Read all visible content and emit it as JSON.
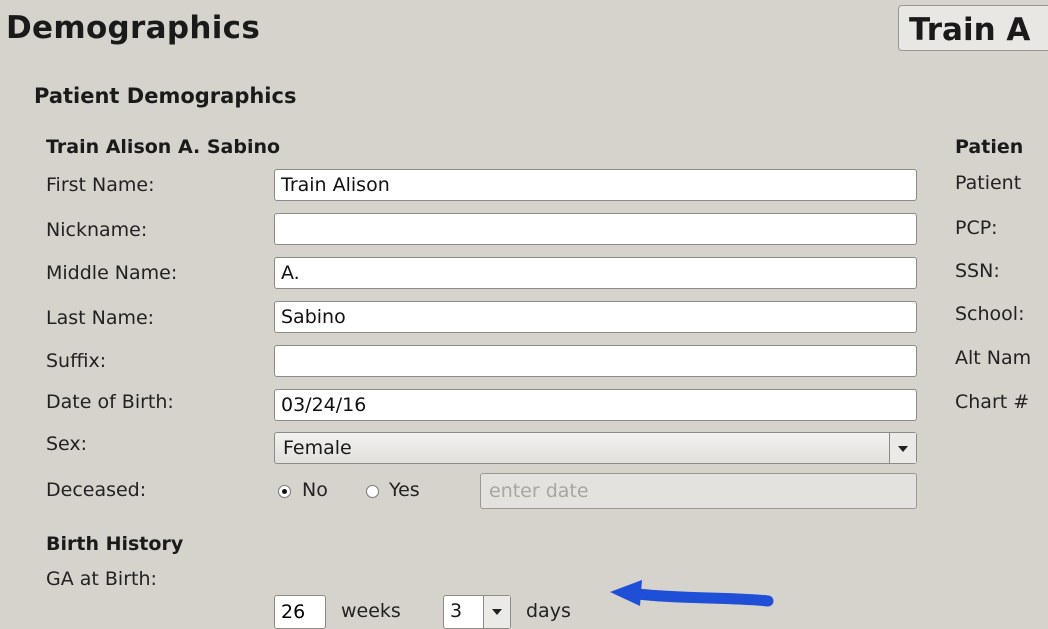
{
  "header": {
    "title": "Demographics",
    "patient_button": "Train A"
  },
  "section": {
    "title": "Patient Demographics",
    "patient_full_name": "Train Alison A. Sabino"
  },
  "form": {
    "first_name": {
      "label": "First Name:",
      "value": "Train Alison"
    },
    "nickname": {
      "label": "Nickname:",
      "value": ""
    },
    "middle_name": {
      "label": "Middle Name:",
      "value": "A."
    },
    "last_name": {
      "label": "Last Name:",
      "value": "Sabino"
    },
    "suffix": {
      "label": "Suffix:",
      "value": ""
    },
    "dob": {
      "label": "Date of Birth:",
      "value": "03/24/16"
    },
    "sex": {
      "label": "Sex:",
      "value": "Female"
    },
    "deceased": {
      "label": "Deceased:",
      "option_no": "No",
      "option_yes": "Yes",
      "selected": "No",
      "date_placeholder": "enter date"
    }
  },
  "birth_history": {
    "title": "Birth History",
    "ga_label": "GA at Birth:",
    "weeks_value": "26",
    "weeks_unit": "weeks",
    "days_value": "3",
    "days_unit": "days"
  },
  "right_panel": {
    "heading": "Patien",
    "labels": [
      "Patient",
      "PCP:",
      "SSN:",
      "School:",
      "Alt Nam",
      "Chart #"
    ]
  },
  "colors": {
    "background": "#d6d3cd",
    "annotation_arrow": "#1f4fd6"
  }
}
